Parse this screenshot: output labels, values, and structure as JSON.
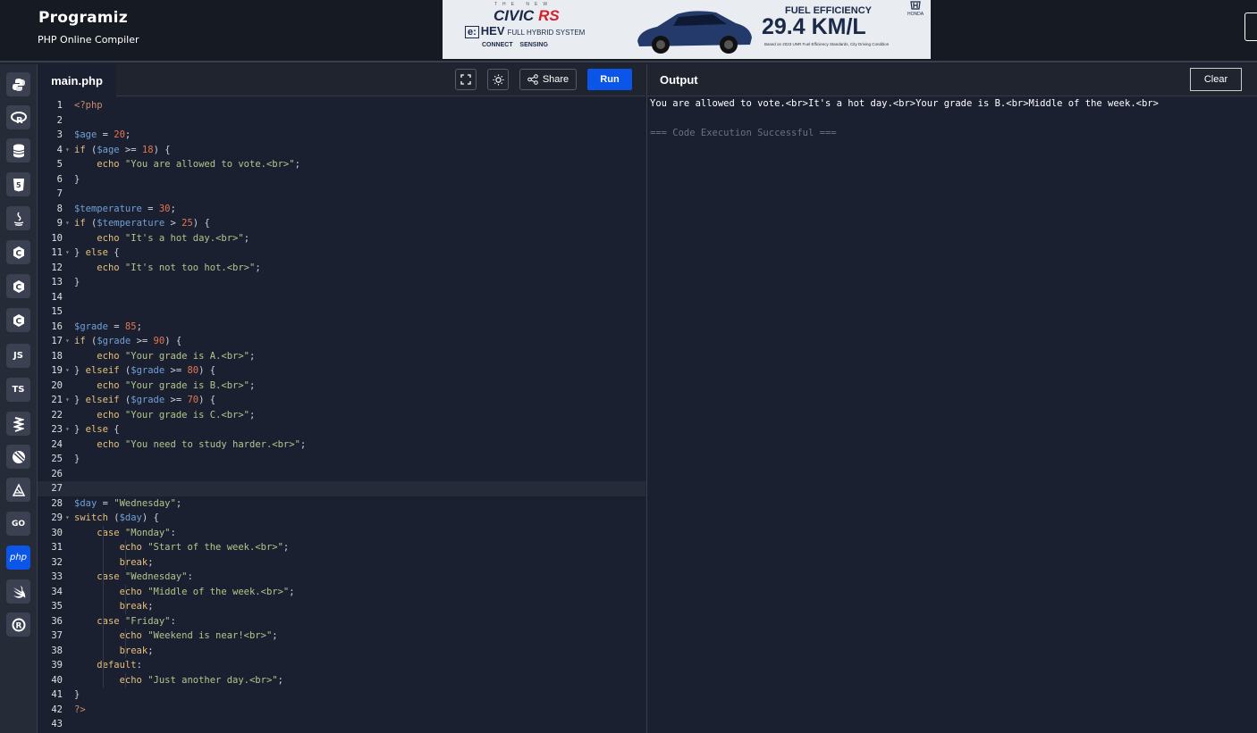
{
  "header": {
    "logo": "Programiz",
    "subtitle": "PHP Online Compiler"
  },
  "ad": {
    "the_new": "THE NEW",
    "model": "CIVIC",
    "model_suffix": "RS",
    "ehev_box": "e:",
    "ehev": "HEV",
    "hybrid": "FULL HYBRID SYSTEM",
    "connect": "CONNECT",
    "sensing": "SENSING",
    "fuel_label": "FUEL EFFICIENCY",
    "fuel_value": "29.4 KM/L",
    "note": "Based on 2023 UNR Fuel Efficiency Standards, City Driving Condition",
    "brand": "HONDA"
  },
  "sidebar": {
    "languages": [
      "python",
      "r",
      "sql",
      "html",
      "java",
      "c",
      "cpp",
      "csharp",
      "JS",
      "TS",
      "go-script",
      "kotlin",
      "dart",
      "GO",
      "php",
      "swift",
      "rust"
    ],
    "active": "php"
  },
  "editor": {
    "tab": "main.php",
    "share_label": "Share",
    "run_label": "Run",
    "lines": [
      "1",
      "2",
      "3",
      "4",
      "5",
      "6",
      "7",
      "8",
      "9",
      "10",
      "11",
      "12",
      "13",
      "14",
      "15",
      "16",
      "17",
      "18",
      "19",
      "20",
      "21",
      "22",
      "23",
      "24",
      "25",
      "26",
      "27",
      "28",
      "29",
      "30",
      "31",
      "32",
      "33",
      "34",
      "35",
      "36",
      "37",
      "38",
      "39",
      "40",
      "41",
      "42",
      "43"
    ],
    "code": [
      "<?php",
      "",
      "$age = 20;",
      "if ($age >= 18) {",
      "    echo \"You are allowed to vote.<br>\";",
      "}",
      "",
      "$temperature = 30;",
      "if ($temperature > 25) {",
      "    echo \"It's a hot day.<br>\";",
      "} else {",
      "    echo \"It's not too hot.<br>\";",
      "}",
      "",
      "",
      "$grade = 85;",
      "if ($grade >= 90) {",
      "    echo \"Your grade is A.<br>\";",
      "} elseif ($grade >= 80) {",
      "    echo \"Your grade is B.<br>\";",
      "} elseif ($grade >= 70) {",
      "    echo \"Your grade is C.<br>\";",
      "} else {",
      "    echo \"You need to study harder.<br>\";",
      "}",
      "",
      "",
      "$day = \"Wednesday\";",
      "switch ($day) {",
      "    case \"Monday\":",
      "        echo \"Start of the week.<br>\";",
      "        break;",
      "    case \"Wednesday\":",
      "        echo \"Middle of the week.<br>\";",
      "        break;",
      "    case \"Friday\":",
      "        echo \"Weekend is near!<br>\";",
      "        break;",
      "    default:",
      "        echo \"Just another day.<br>\";",
      "}",
      "?>",
      ""
    ]
  },
  "output": {
    "title": "Output",
    "clear_label": "Clear",
    "text": "You are allowed to vote.<br>It's a hot day.<br>Your grade is B.<br>Middle of the week.<br>",
    "status": "=== Code Execution Successful ==="
  }
}
